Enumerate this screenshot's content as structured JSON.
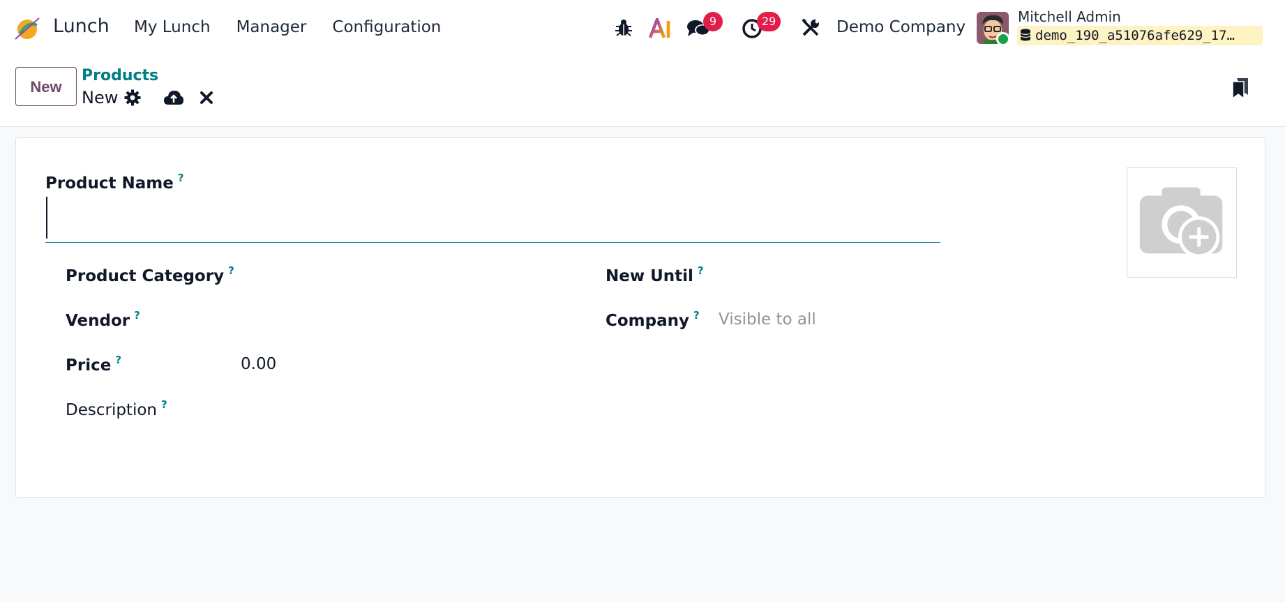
{
  "navbar": {
    "app_name": "Lunch",
    "menu": [
      "My Lunch",
      "Manager",
      "Configuration"
    ],
    "messages_count": "9",
    "activities_count": "29",
    "company": "Demo Company",
    "user_name": "Mitchell Admin",
    "database": "demo_190_a51076afe629_17…"
  },
  "control_panel": {
    "new_label": "New",
    "breadcrumb": "Products",
    "record_title": "New"
  },
  "form": {
    "product_name_label": "Product Name",
    "product_name_value": "",
    "help_mark": "?",
    "left": {
      "category_label": "Product Category",
      "vendor_label": "Vendor",
      "price_label": "Price",
      "price_value": "0.00",
      "description_label": "Description"
    },
    "right": {
      "new_until_label": "New Until",
      "company_label": "Company",
      "company_placeholder": "Visible to all"
    }
  },
  "colors": {
    "brand": "#714b67",
    "accent": "#017e84",
    "badge": "#e11d48",
    "db_highlight": "#fdf3c3"
  },
  "icons": [
    "app-logo-icon",
    "bug-icon",
    "ai-icon",
    "chat-icon",
    "clock-icon",
    "tools-icon",
    "database-icon",
    "gear-icon",
    "cloud-upload-icon",
    "close-icon",
    "bookmark-icon",
    "camera-plus-icon"
  ]
}
